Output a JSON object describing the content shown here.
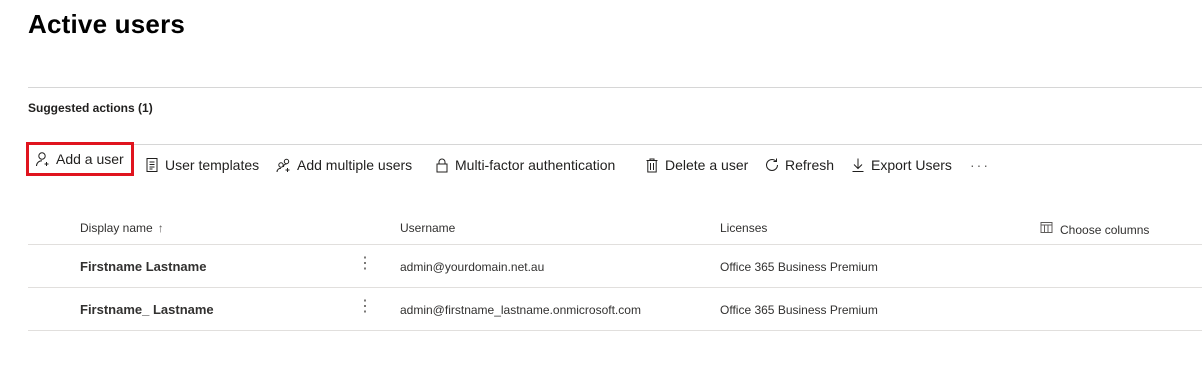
{
  "page": {
    "title": "Active users"
  },
  "suggested_actions": {
    "label": "Suggested actions (1)"
  },
  "toolbar": {
    "add_user": "Add a user",
    "user_templates": "User templates",
    "add_multiple": "Add multiple users",
    "mfa": "Multi-factor authentication",
    "delete_user": "Delete a user",
    "refresh": "Refresh",
    "export": "Export Users",
    "more": "···"
  },
  "table": {
    "columns": {
      "display_name": "Display name",
      "sort_indicator": "↑",
      "username": "Username",
      "licenses": "Licenses",
      "choose_columns": "Choose columns"
    },
    "rows": [
      {
        "display_name": "Firstname Lastname",
        "username": "admin@yourdomain.net.au",
        "licenses": "Office 365 Business Premium"
      },
      {
        "display_name": "Firstname_ Lastname",
        "username": "admin@firstname_lastname.onmicrosoft.com",
        "licenses": "Office 365 Business Premium"
      }
    ],
    "row_menu_glyph": "⋮"
  },
  "colors": {
    "highlight_border": "#e0141e",
    "divider": "#d6d6d6",
    "text": "#201f1e"
  }
}
